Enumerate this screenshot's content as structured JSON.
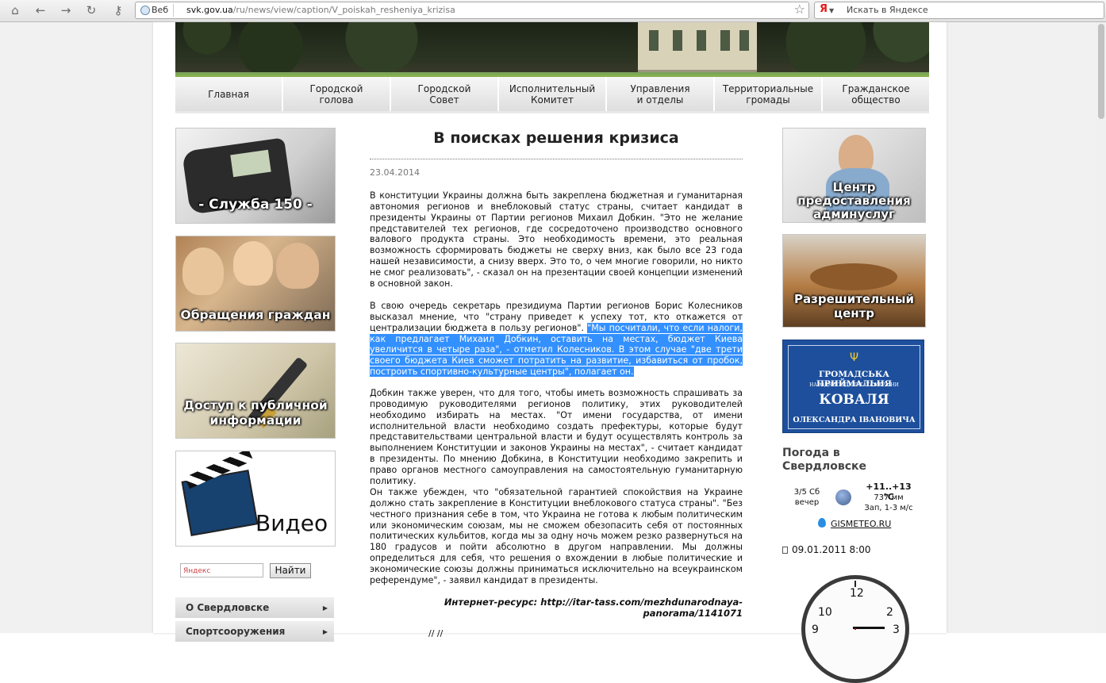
{
  "browser": {
    "web_tag": "Веб",
    "url_host": "svk.gov.ua",
    "url_path": "/ru/news/view/caption/V_poiskah_resheniya_krizisa",
    "ya_letter": "Я",
    "search_placeholder": "Искать в Яндексе",
    "icons": [
      "home-icon",
      "back-icon",
      "forward-icon",
      "reload-icon",
      "key-icon",
      "globe-icon",
      "bookmark-star-icon",
      "yandex-icon"
    ]
  },
  "topmenu": [
    {
      "label": "Главная"
    },
    {
      "label": "Городской\nголова"
    },
    {
      "label": "Городской\nСовет"
    },
    {
      "label": "Исполнительный\nКомитет"
    },
    {
      "label": "Управления\nи отделы"
    },
    {
      "label": "Территориальные\nгромады"
    },
    {
      "label": "Гражданское\nобщество"
    }
  ],
  "left": {
    "tiles": [
      {
        "caption": "- Служба 150 -"
      },
      {
        "caption": "Обращения граждан"
      },
      {
        "caption_1": "Доступ к публичной",
        "caption_2": "информации"
      },
      {
        "caption": "Видео"
      }
    ],
    "search_placeholder": "Яндекс",
    "search_button": "Найти",
    "menu": [
      {
        "label": "О Свердловске"
      },
      {
        "label": "Спортсооружения"
      }
    ]
  },
  "article": {
    "title": "В поисках решения кризиса",
    "date": "23.04.2014",
    "p1": "В конституции Украины должна быть закреплена бюджетная и гуманитарная автономия регионов и внеблоковый статус страны, считает кандидат в президенты Украины от Партии регионов Михаил Добкин. \"Это не желание представителей тех регионов, где сосредоточено производство основного валового продукта страны. Это необходимость времени, это реальная возможность сформировать бюджеты не сверху вниз, как было все 23 года нашей независимости, а снизу вверх. Это то, о чем многие говорили, но никто не смог реализовать\", - сказал он на презентации своей концепции изменений в основной закон.",
    "p2_plain": "В свою очередь секретарь президиума Партии регионов Борис Колесников высказал мнение, что \"страну приведет к успеху тот, кто откажется от централизации бюджета в пользу регионов\". ",
    "p2_highlight": "\"Мы посчитали, что если налоги, как предлагает Михаил Добкин, оставить на местах, бюджет Киева увеличится в четыре раза\", - отметил Колесников. В этом случае \"две трети своего бюджета Киев сможет потратить на развитие, избавиться от пробок, построить спортивно-культурные центры\", полагает он.",
    "p3": "Добкин также уверен, что для того, чтобы иметь возможность спрашивать за проводимую руководителями регионов политику, этих руководителей необходимо избирать на местах. \"От имени государства, от имени исполнительной власти необходимо создать префектуры, которые будут представительствами центральной власти и будут осуществлять контроль за выполнением Конституции и законов Украины на местах\", - считает кандидат в президенты. По мнению Добкина, в Конституции необходимо закрепить и право органов местного самоуправления на самостоятельную гуманитарную политику.",
    "p4": "Он также убежден, что \"обязательной гарантией спокойствия на Украине должно стать закрепление в Конституции внеблокового статуса страны\". \"Без честного признания себе в том, что Украина не готова к любым политическим или экономическим союзам, мы не сможем обезопасить себя от постоянных политических кульбитов, когда мы за одну ночь можем резко развернуться на 180 градусов и пойти абсолютно в другом направлении. Мы должны определиться для себя, что решения о вхождении в любые политические и экономические союзы должны приниматься исключительно на всеукраинском референдуме\", - заявил кандидат в президенты.",
    "source_1": "Интернет-ресурс: http://itar-tass.com/mezhdunarodnaya-",
    "source_2": "panorama/1141071",
    "cut_line": "// //"
  },
  "right": {
    "tile1": {
      "line1": "Центр",
      "line2": "предоставления",
      "line3": "админуслуг"
    },
    "tile2": {
      "line1": "Разрешительный",
      "line2": "центр"
    },
    "reception": {
      "line1": "ГРОМАДСЬКА ПРИЙМАЛЬНЯ",
      "line2": "НАРОДНОГО ДЕПУТАТА УКРАЇНИ",
      "line3": "КОВАЛЯ",
      "line4": "ОЛЕКСАНДРА ІВАНОВИЧА"
    },
    "weather": {
      "title": "Погода в\nСвердловске",
      "date_1": "3/5 Сб",
      "date_2": "вечер",
      "temp": "+11..+13 °C",
      "pressure": "737 мм",
      "wind": "Зап, 1-3 м/с",
      "link": "GISMETEO.RU"
    },
    "news_date": "09.01.2011 8:00",
    "clock": {
      "n12": "12",
      "n10": "10",
      "n2": "2",
      "n9": "9",
      "n3": "3"
    }
  }
}
